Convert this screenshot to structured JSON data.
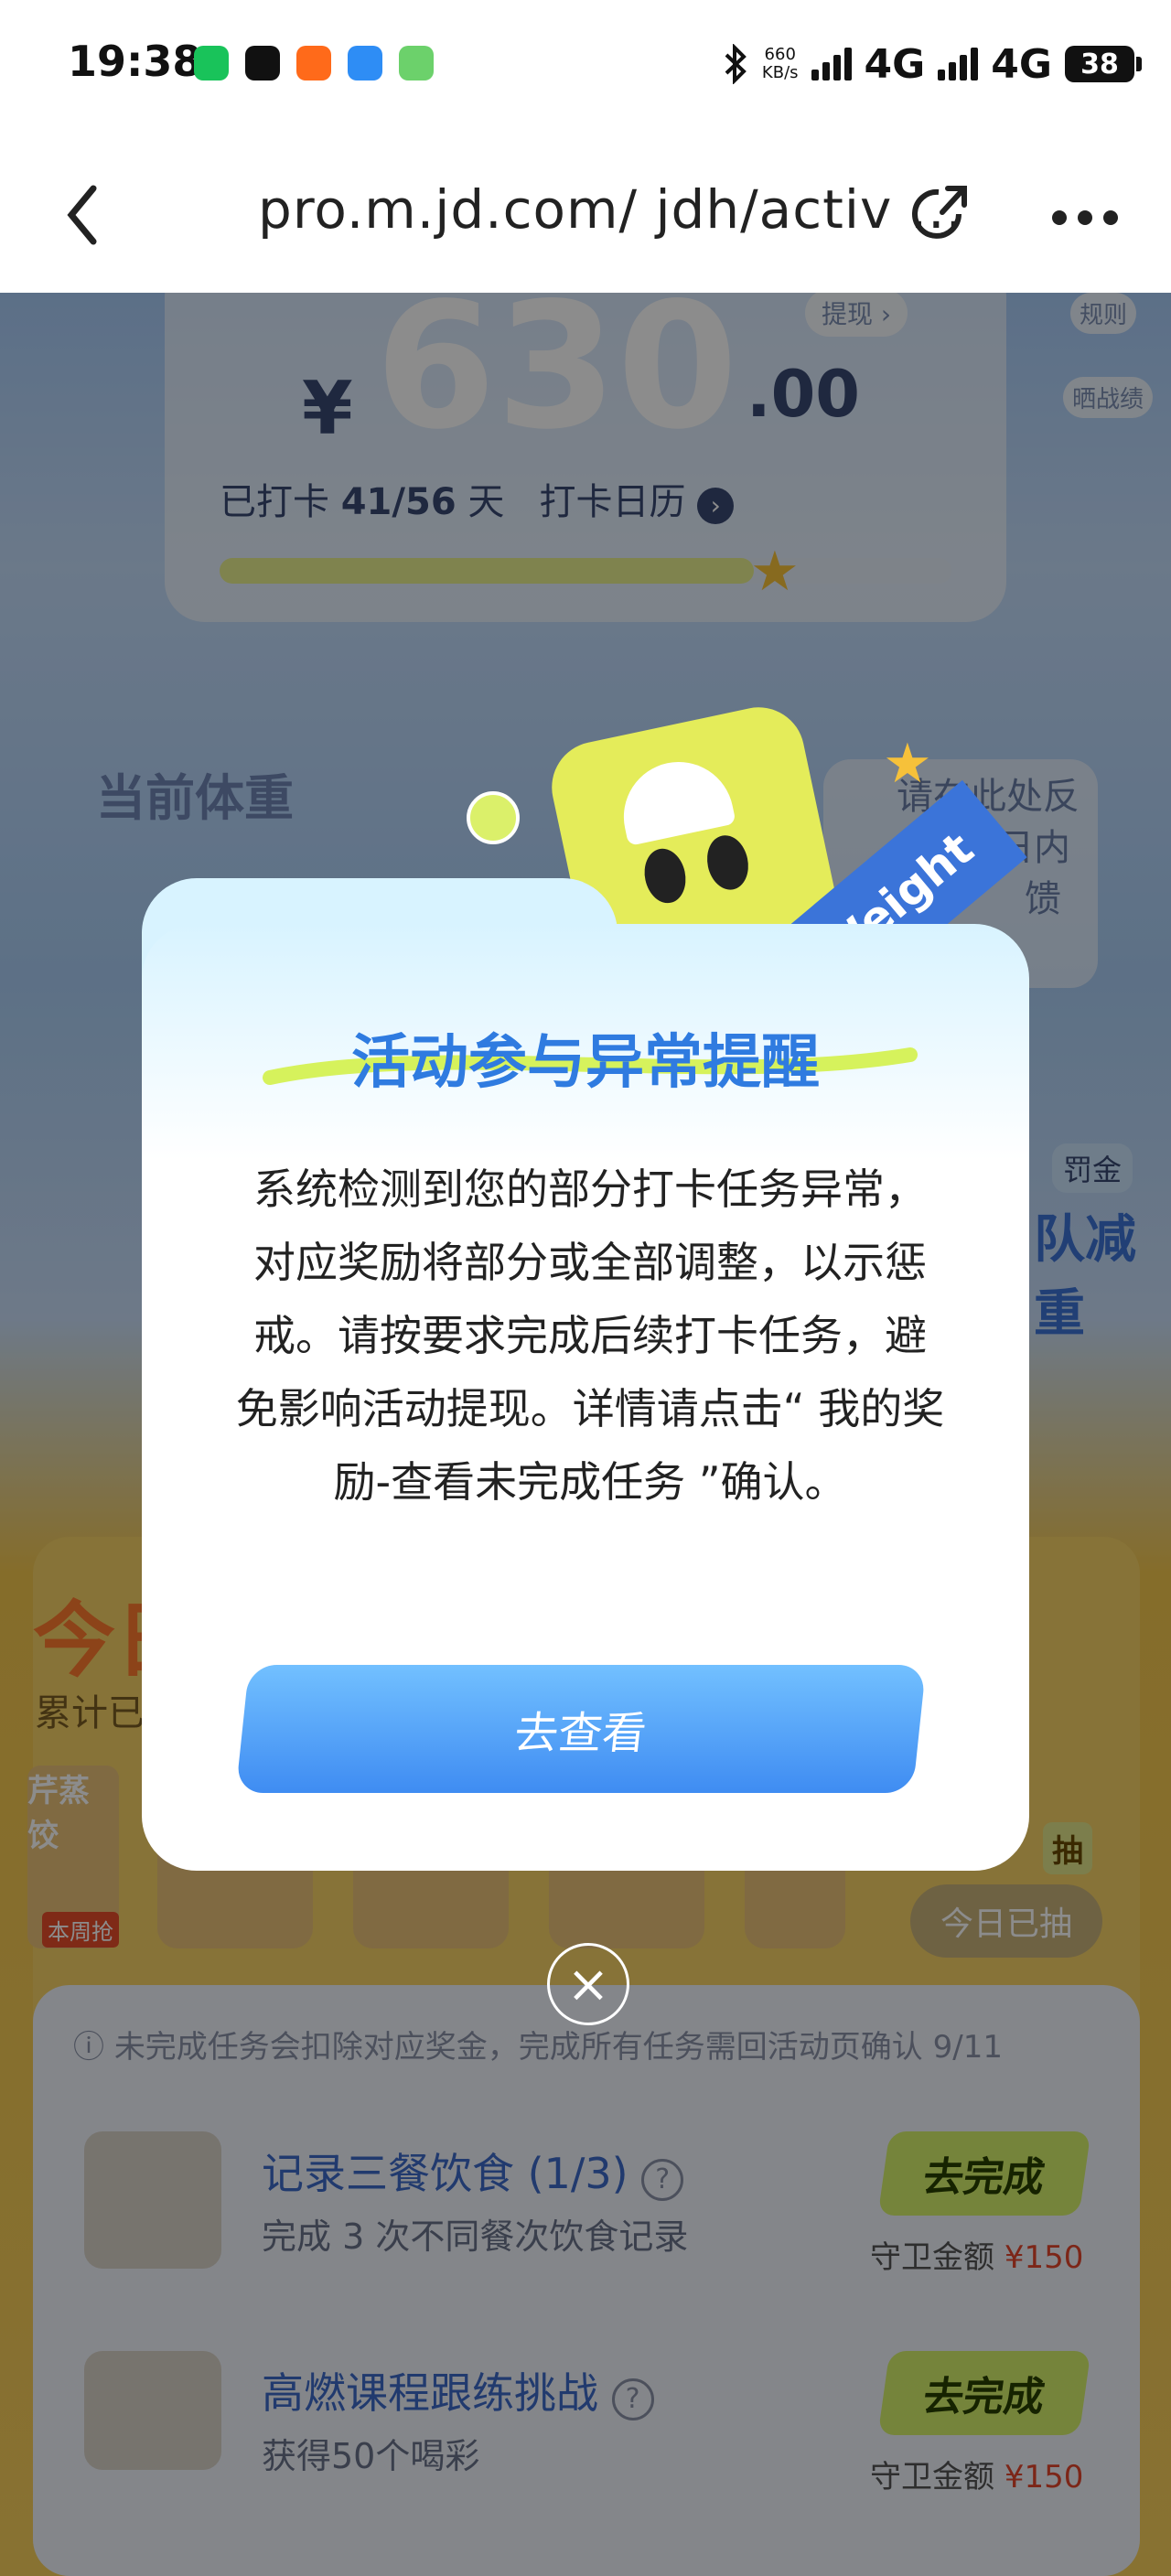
{
  "status_bar": {
    "time": "19:38",
    "net_rate_value": "660",
    "net_rate_unit": "KB/s",
    "net1": "4G",
    "net2": "4G",
    "battery": "38"
  },
  "browser": {
    "url": "pro.m.jd.com/ jdh/activ ..."
  },
  "page": {
    "withdraw_label": "提现",
    "rules_label": "规则",
    "share_label": "晒战绩",
    "amount_yen": "¥",
    "amount": "630",
    "amount_decimal": ".00",
    "checkin_prefix": "已打卡",
    "checkin_count": "41/56",
    "checkin_suffix": "天",
    "calendar_link": "打卡日历",
    "checkin_progress": 0.73,
    "weight_label": "当前体重",
    "tip_lines": [
      "请在此处反",
      "日内",
      "馈"
    ],
    "penalty_tag": "罚金",
    "team_label": "队减重",
    "notice": "未完成任务会扣除对应奖金，完成所有任务需回活动页确认 9/11",
    "today_drawn": "今日已抽",
    "draw_tag": "抽",
    "accumulated": "累计已",
    "today_big": "今日",
    "dumpling": "芹蒸饺",
    "this_week": "本周抢"
  },
  "tasks": [
    {
      "title": "记录三餐饮食 (1/3)",
      "subtitle": "完成 3 次不同餐次饮食记录",
      "button": "去完成",
      "guard_label": "守卫金额",
      "guard_amount": "¥150"
    },
    {
      "title": "高燃课程跟练挑战",
      "subtitle": "获得50个喝彩",
      "button": "去完成",
      "guard_label": "守卫金额",
      "guard_amount": "¥150"
    }
  ],
  "modal": {
    "title": "活动参与异常提醒",
    "body": "系统检测到您的部分打卡任务异常，对应奖励将部分或全部调整，以示惩戒。请按要求完成后续打卡任务，避免影响活动提现。详情请点击“ 我的奖励-查看未完成任务 ”确认。",
    "button": "去查看",
    "mascot_badge": "Weight"
  },
  "colors": {
    "accent_blue": "#3f8cf2",
    "title_blue": "#2f7be0",
    "go_green": "#d6f06c",
    "money_red": "#e2462c"
  },
  "icons": [
    "back-arrow-icon",
    "share-icon",
    "more-icon",
    "bluetooth-icon",
    "close-icon",
    "help-icon",
    "chevron-right-icon"
  ]
}
